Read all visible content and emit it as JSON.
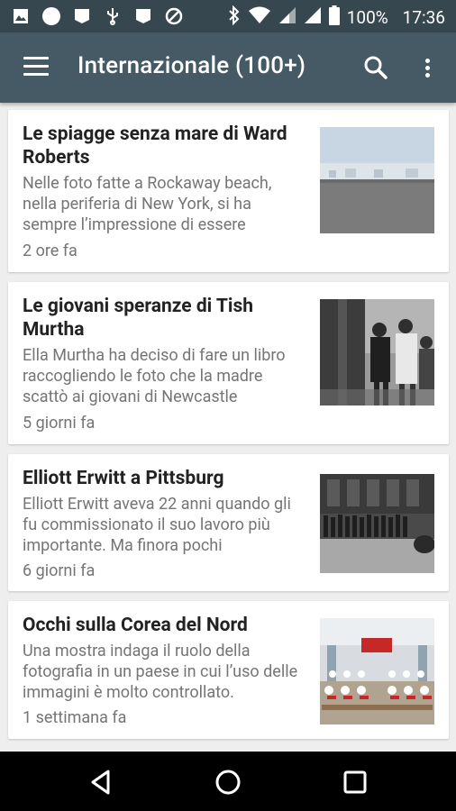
{
  "status_bar": {
    "battery_text": "100%",
    "time": "17:36"
  },
  "app_bar": {
    "title": "Internazionale (100+)"
  },
  "articles": [
    {
      "title": "Le spiagge senza mare di Ward Roberts",
      "description": "Nelle foto fatte a Rockaway beach, nella periferia di New York, si ha sempre l’impressione di essere",
      "time": "2 ore fa"
    },
    {
      "title": "Le giovani speranze di Tish Murtha",
      "description": "Ella Murtha ha deciso di fare un libro raccogliendo le foto che la madre scattò ai giovani di Newcastle",
      "time": "5 giorni fa"
    },
    {
      "title": "Elliott Erwitt a Pittsburg",
      "description": "Elliott Erwitt aveva 22 anni quando gli fu commissionato il suo lavoro più importante. Ma finora pochi",
      "time": "6 giorni fa"
    },
    {
      "title": "Occhi sulla Corea del Nord",
      "description": "Una mostra indaga il ruolo della fotografia in un paese in cui l’uso delle immagini è molto controllato.",
      "time": "1 settimana fa"
    }
  ],
  "colors": {
    "status_bar": "#37474f",
    "app_bar": "#455a64",
    "background": "#eeeeee"
  }
}
